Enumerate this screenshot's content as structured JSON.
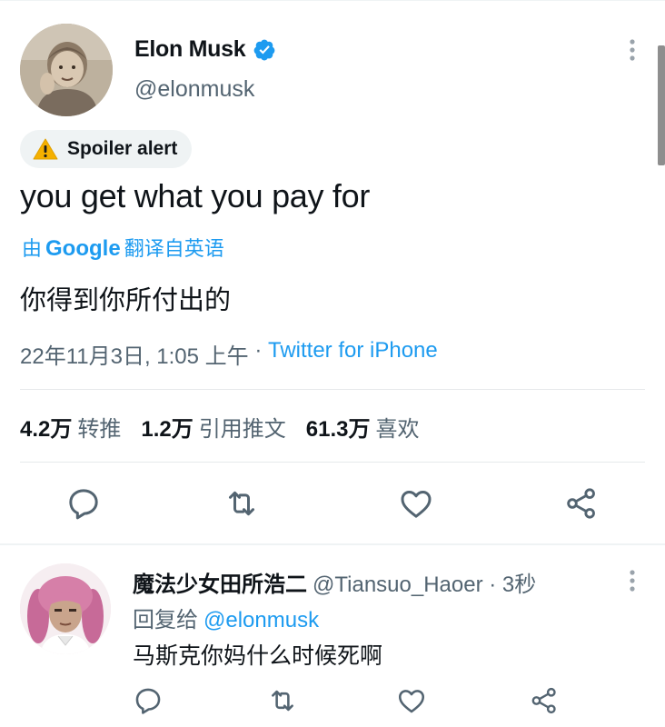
{
  "tweet": {
    "author": {
      "name": "Elon Musk",
      "handle": "@elonmusk"
    },
    "spoiler": {
      "label": "Spoiler alert"
    },
    "text": "you get what you pay for",
    "translation": {
      "prefix": "由",
      "provider": "Google",
      "suffix": "翻译自英语",
      "text": "你得到你所付出的"
    },
    "meta": {
      "date": "22年11月3日, 1:05 上午",
      "dot": " · ",
      "source": "Twitter for iPhone"
    },
    "stats": [
      {
        "value": "4.2万",
        "label": "转推"
      },
      {
        "value": "1.2万",
        "label": "引用推文"
      },
      {
        "value": "61.3万",
        "label": "喜欢"
      }
    ],
    "actions": [
      "reply-icon",
      "retweet-icon",
      "like-icon",
      "share-icon"
    ]
  },
  "reply": {
    "name": "魔法少女田所浩二",
    "handle": "@Tiansuo_Haoer",
    "time": " · 3秒",
    "reply_prefix": "回复给",
    "reply_to": "@elonmusk",
    "text": "马斯克你妈什么时候死啊"
  },
  "colors": {
    "accent": "#1d9bf0",
    "secondary_text": "#536471",
    "text": "#0f1419",
    "warning": "#f5b000"
  }
}
